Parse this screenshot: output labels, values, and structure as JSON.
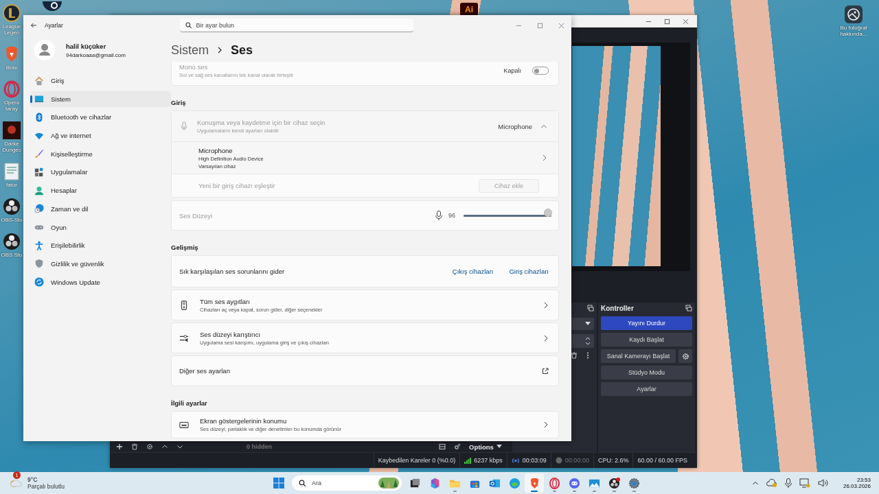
{
  "desktop": {
    "icons": [
      {
        "kind": "league",
        "label": "League Legen"
      },
      {
        "kind": "brave",
        "label": "Brav"
      },
      {
        "kind": "opera",
        "label": "Opera taray"
      },
      {
        "kind": "darkest",
        "label": "Darke Dungec"
      },
      {
        "kind": "document",
        "label": "fatur"
      },
      {
        "kind": "obs",
        "label": "OBS-Stu"
      },
      {
        "kind": "obs",
        "label": "OBS Stu"
      }
    ],
    "top_icons": [
      {
        "kind": "steam"
      },
      {
        "kind": "illustrator",
        "glyph": "Ai"
      }
    ],
    "photo_info": {
      "label": "Bu fotoğraf hakkında..."
    }
  },
  "obs": {
    "toolbars": {
      "scenes_count": "0 hidden",
      "options": "Options"
    },
    "controls": {
      "title": "Kontroller",
      "buttons": [
        {
          "label": "Yayını Durdur",
          "active": true,
          "settings": false
        },
        {
          "label": "Kaydı Başlat",
          "active": false,
          "settings": false
        },
        {
          "label": "Sanal Kamerayı Başlat",
          "active": false,
          "settings": true
        },
        {
          "label": "Stüdyo Modu",
          "active": false,
          "settings": false
        },
        {
          "label": "Ayarlar",
          "active": false,
          "settings": false
        }
      ]
    },
    "status_bar": [
      {
        "kind": "text",
        "text": "Kaybedilen Kareler 0 (%0.0)",
        "disabled": false
      },
      {
        "kind": "bitrate",
        "text": "6237 kbps",
        "disabled": false
      },
      {
        "kind": "stream",
        "text": "00:03:09",
        "disabled": false
      },
      {
        "kind": "record",
        "text": "00:00:00",
        "disabled": true
      },
      {
        "kind": "text",
        "text": "CPU: 2.6%",
        "disabled": false
      },
      {
        "kind": "text",
        "text": "60.00 / 60.00 FPS",
        "disabled": false
      }
    ]
  },
  "settings": {
    "title": "Ayarlar",
    "search": {
      "placeholder": "Bir ayar bulun"
    },
    "user": {
      "name": "halil küçüker",
      "email": "94darkoaaa@gmail.com"
    },
    "nav": [
      {
        "kind": "home",
        "label": "Giriş",
        "selected": false
      },
      {
        "kind": "system",
        "label": "Sistem",
        "selected": true
      },
      {
        "kind": "bluetooth",
        "label": "Bluetooth ve cihazlar",
        "selected": false
      },
      {
        "kind": "network",
        "label": "Ağ ve internet",
        "selected": false
      },
      {
        "kind": "personalize",
        "label": "Kişiselleştirme",
        "selected": false
      },
      {
        "kind": "apps",
        "label": "Uygulamalar",
        "selected": false
      },
      {
        "kind": "accounts",
        "label": "Hesaplar",
        "selected": false
      },
      {
        "kind": "time",
        "label": "Zaman ve dil",
        "selected": false
      },
      {
        "kind": "gaming",
        "label": "Oyun",
        "selected": false
      },
      {
        "kind": "accessibility",
        "label": "Erişilebilirlik",
        "selected": false
      },
      {
        "kind": "privacy",
        "label": "Gizlilik ve güvenlik",
        "selected": false
      },
      {
        "kind": "update",
        "label": "Windows Update",
        "selected": false
      }
    ],
    "breadcrumb": {
      "parent": "Sistem",
      "current": "Ses"
    },
    "mono": {
      "title": "Mono ses",
      "subtitle": "Sol ve sağ ses kanallarını tek kanal olarak birleştir",
      "state_label": "Kapalı",
      "on": false,
      "disabled": true
    },
    "input": {
      "heading": "Giriş",
      "select": {
        "title": "Konuşma veya kaydetme için bir cihaz seçin",
        "subtitle": "Uygulamaların kendi ayarları olabilir",
        "value": "Microphone",
        "expanded": true,
        "disabled": true
      },
      "device": {
        "name": "Microphone",
        "lines": [
          "High Definition Audio Device",
          "Varsayılan cihaz"
        ]
      },
      "pair": {
        "label": "Yeni bir giriş cihazı eşleştir",
        "button": "Cihaz ekle",
        "disabled": true
      },
      "volume": {
        "label": "Ses Düzeyi",
        "reading": "96",
        "level": 0.96,
        "disabled": true
      }
    },
    "advanced": {
      "heading": "Gelişmiş",
      "troubleshoot": {
        "label": "Sık karşılaşılan ses sorunlarını gider",
        "links": [
          "Çıkış cihazları",
          "Giriş cihazları"
        ]
      },
      "rows": [
        {
          "kind": "devices",
          "title": "Tüm ses aygıtları",
          "subtitle": "Cihazları aç veya kapat, sorun gider, diğer seçenekler"
        },
        {
          "kind": "mixer",
          "title": "Ses düzeyi karıştırıcı",
          "subtitle": "Uygulama sesi karışımı, uygulama giriş ve çıkış cihazları"
        },
        {
          "kind": "plain",
          "title": "Diğer ses ayarları"
        }
      ]
    },
    "related": {
      "heading": "İlgili ayarlar",
      "rows": [
        {
          "kind": "display",
          "title": "Ekran göstergelerinin konumu",
          "subtitle": "Ses düzeyi, parlaklık ve diğer denetimler bu konumda görünür"
        }
      ]
    }
  },
  "taskbar": {
    "weather": {
      "badge": "1",
      "temperature": "9°C",
      "condition": "Parçalı bulutlu"
    },
    "search": {
      "placeholder": "Ara"
    },
    "apps": [
      {
        "kind": "taskview",
        "running": false,
        "selected": false
      },
      {
        "kind": "m365",
        "running": false,
        "selected": false
      },
      {
        "kind": "explorer",
        "running": true,
        "selected": false
      },
      {
        "kind": "store",
        "running": false,
        "selected": false
      },
      {
        "kind": "outlook",
        "running": false,
        "selected": false
      },
      {
        "kind": "edge",
        "running": false,
        "selected": false
      },
      {
        "kind": "brave",
        "running": true,
        "selected": true
      },
      {
        "kind": "opera",
        "running": true,
        "selected": false
      },
      {
        "kind": "discord",
        "running": true,
        "selected": false
      },
      {
        "kind": "monitor",
        "running": true,
        "selected": false
      },
      {
        "kind": "obs",
        "running": true,
        "selected": false
      },
      {
        "kind": "settings",
        "running": true,
        "selected": false
      }
    ],
    "clock": {
      "time": "23:53",
      "date": "26.03.2026"
    }
  }
}
